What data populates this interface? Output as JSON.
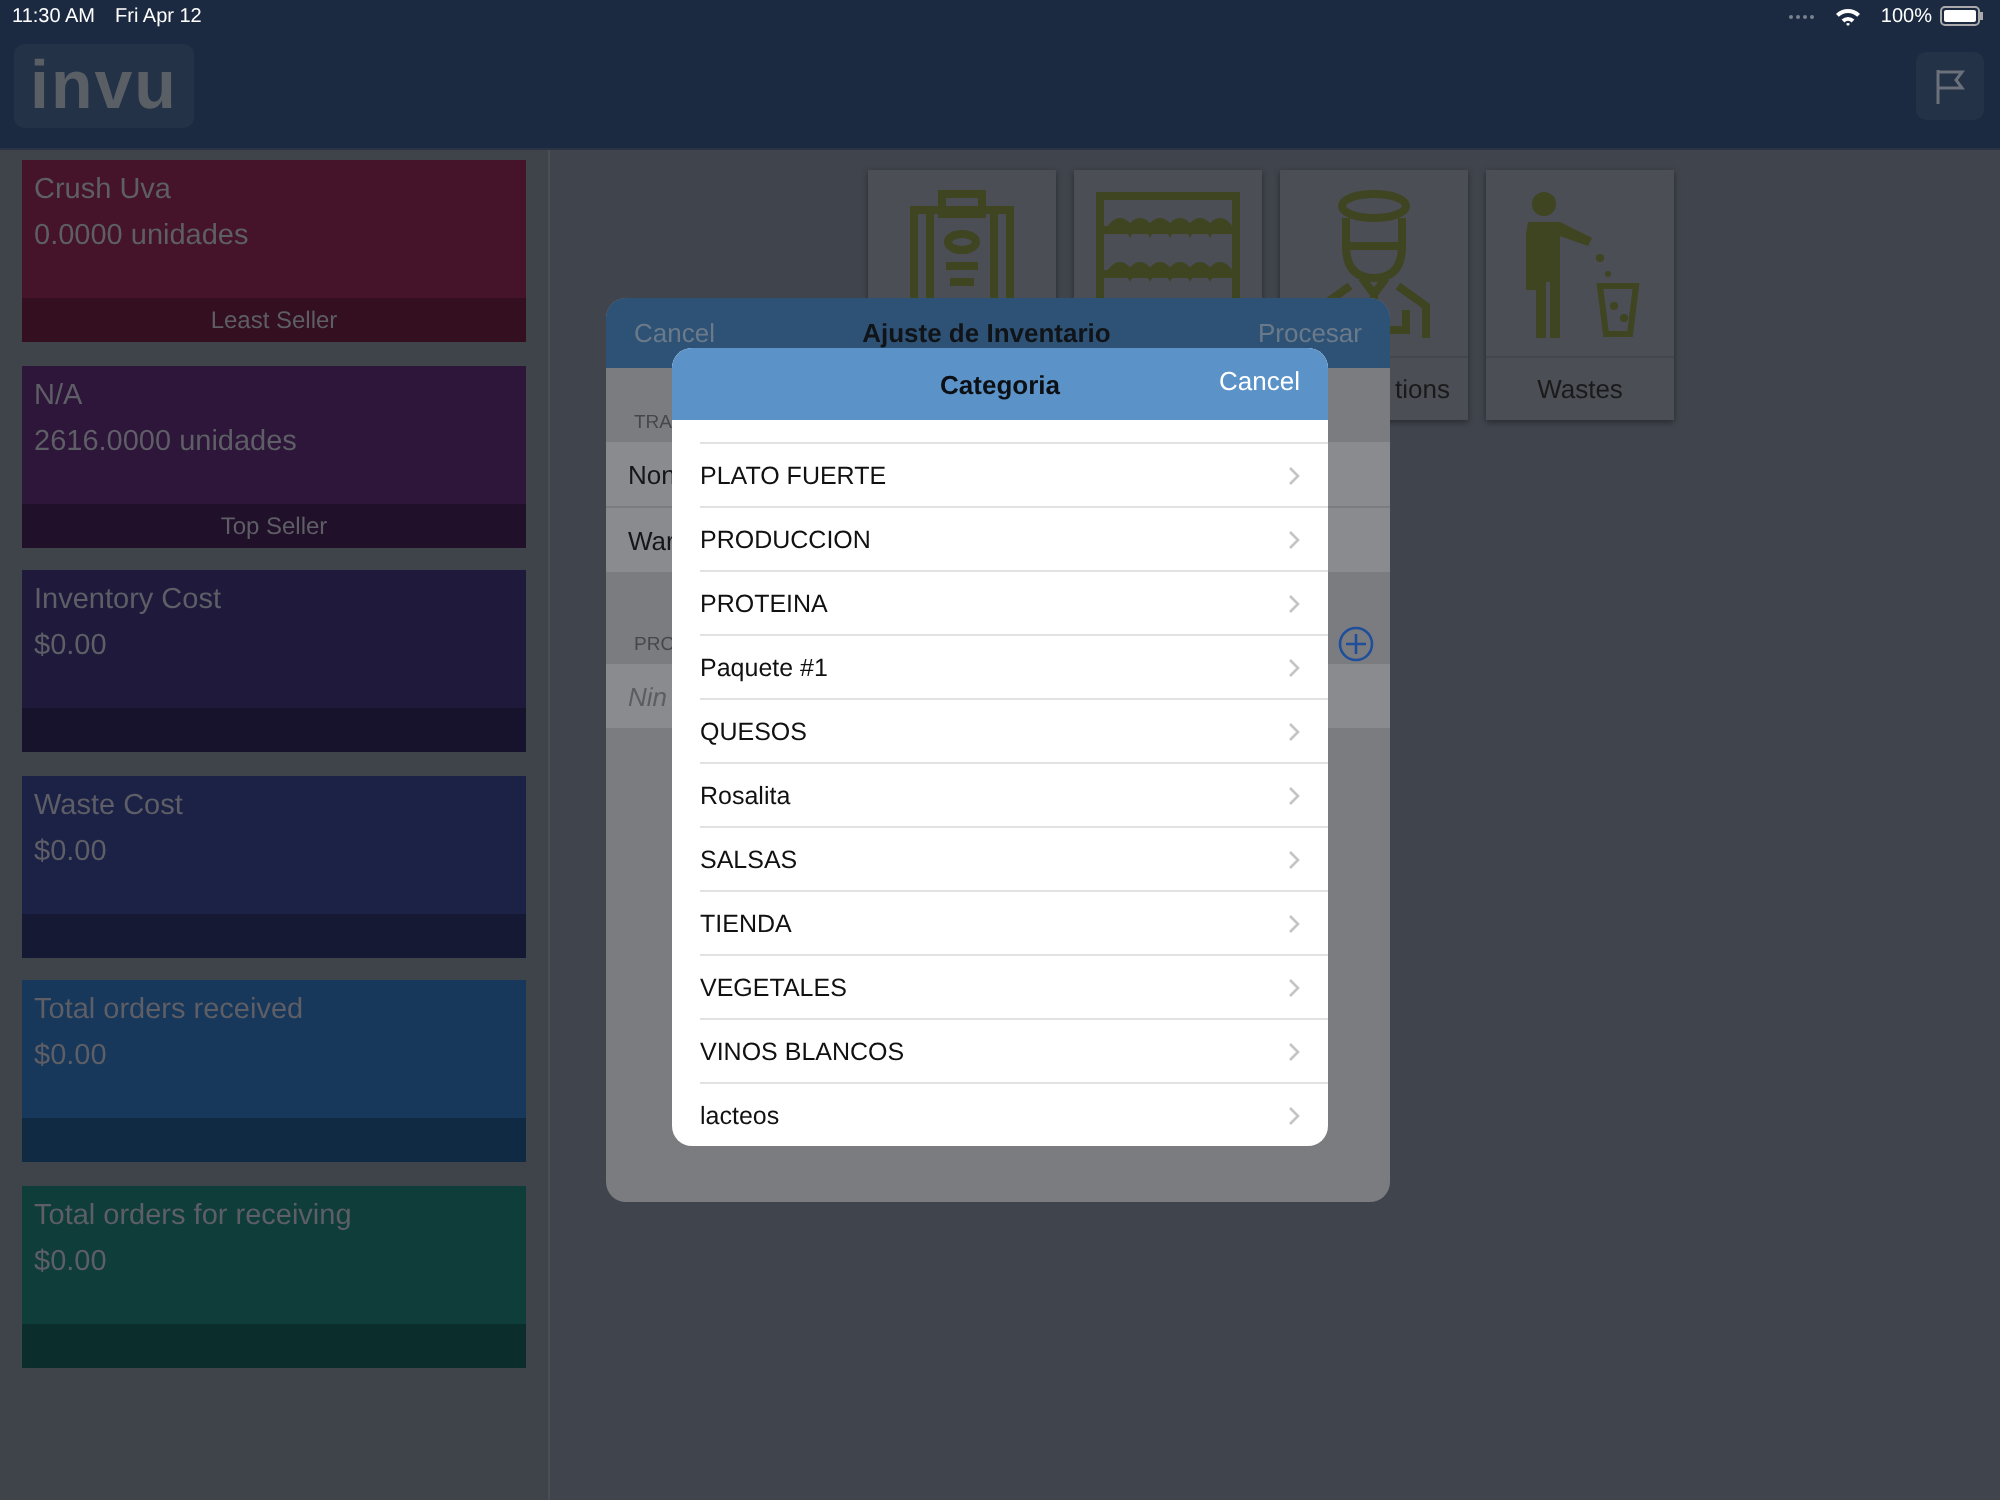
{
  "status_bar": {
    "time": "11:30 AM",
    "date": "Fri Apr 12",
    "battery": "100%"
  },
  "header": {
    "logo": "invu"
  },
  "cards": [
    {
      "title": "Crush Uva",
      "value": "0.0000 unidades",
      "footer": "Least Seller",
      "color": "#45142a"
    },
    {
      "title": "N/A",
      "value": "2616.0000 unidades",
      "footer": "Top Seller",
      "color": "#2d1639"
    },
    {
      "title": "Inventory Cost",
      "value": "$0.00",
      "color": "#1f1a3c"
    },
    {
      "title": "Waste Cost",
      "value": "$0.00",
      "color": "#1c2246"
    },
    {
      "title": "Total orders received",
      "value": "$0.00",
      "color": "#17385a"
    },
    {
      "title": "Total orders for receiving",
      "value": "$0.00",
      "color": "#0f3d3a"
    }
  ],
  "tiles": [
    {
      "kind": "clipboard"
    },
    {
      "kind": "shelf"
    },
    {
      "kind": "chef",
      "label": "tions"
    },
    {
      "kind": "waste",
      "label": "Wastes"
    }
  ],
  "sheet": {
    "cancel": "Cancel",
    "title": "Ajuste de Inventario",
    "process": "Procesar",
    "section_1": "TRA",
    "rows": [
      "Non",
      "War"
    ],
    "section_2": "PRO",
    "empty": "Nin"
  },
  "picker": {
    "title": "Categoria",
    "cancel": "Cancel",
    "items": [
      "PLATO FUERTE",
      "PRODUCCION",
      "PROTEINA",
      "Paquete #1",
      "QUESOS",
      "Rosalita",
      "SALSAS",
      "TIENDA",
      "VEGETALES",
      "VINOS BLANCOS",
      "lacteos"
    ]
  }
}
